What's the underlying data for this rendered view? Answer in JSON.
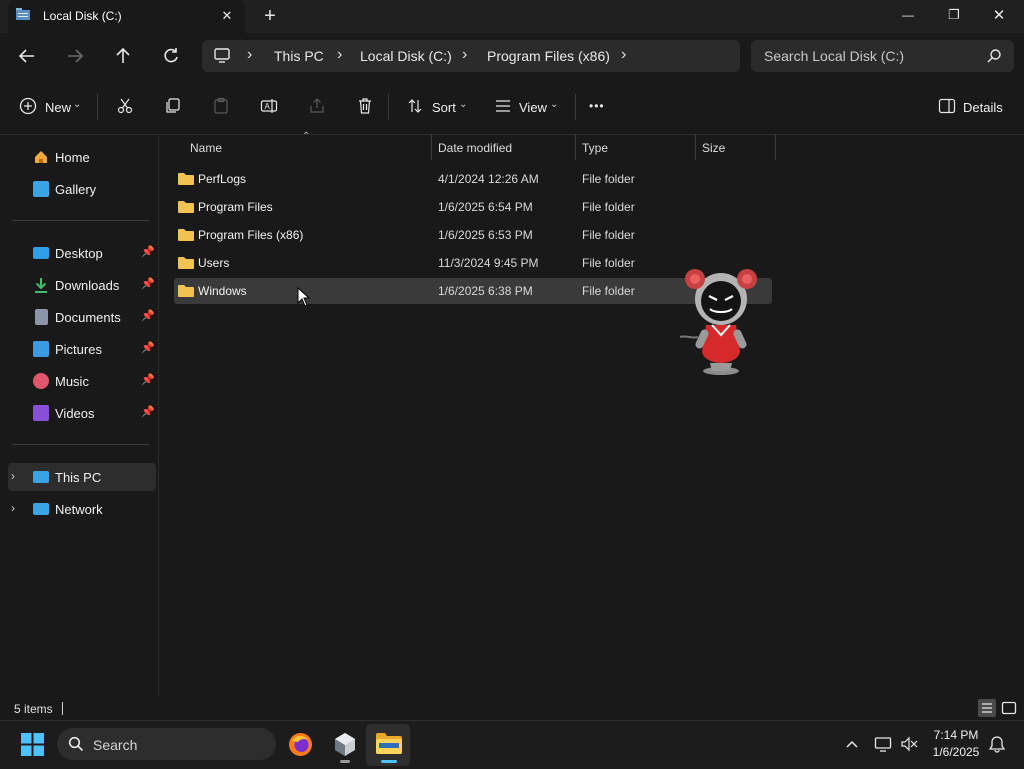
{
  "window": {
    "tab_title": "Local Disk (C:)",
    "new_tab": "+",
    "min": "—",
    "max": "❐",
    "close": "✕",
    "tab_close": "✕"
  },
  "address": {
    "crumbs": [
      "This PC",
      "Local Disk (C:)",
      "Program Files (x86)"
    ],
    "search_placeholder": "Search Local Disk (C:)"
  },
  "commands": {
    "new": "New",
    "sort": "Sort",
    "view": "View",
    "details": "Details",
    "more": "•••"
  },
  "nav": {
    "top": [
      {
        "label": "Home",
        "icon": "home-icon",
        "color": "#f4a93b"
      },
      {
        "label": "Gallery",
        "icon": "gallery-icon",
        "color": "#3aa3e6"
      }
    ],
    "pinned": [
      {
        "label": "Desktop",
        "icon": "desktop-icon",
        "color": "#2f9ee8"
      },
      {
        "label": "Downloads",
        "icon": "downloads-icon",
        "color": "#3fbf6a"
      },
      {
        "label": "Documents",
        "icon": "documents-icon",
        "color": "#8c96a6"
      },
      {
        "label": "Pictures",
        "icon": "pictures-icon",
        "color": "#3a9be3"
      },
      {
        "label": "Music",
        "icon": "music-icon",
        "color": "#e0566a"
      },
      {
        "label": "Videos",
        "icon": "videos-icon",
        "color": "#8a4fd8"
      }
    ],
    "roots": [
      {
        "label": "This PC",
        "icon": "this-pc-icon",
        "color": "#3aa3e6"
      },
      {
        "label": "Network",
        "icon": "network-icon",
        "color": "#3aa3e6"
      }
    ]
  },
  "columns": {
    "name": "Name",
    "date": "Date modified",
    "type": "Type",
    "size": "Size"
  },
  "files": [
    {
      "name": "PerfLogs",
      "date": "4/1/2024 12:26 AM",
      "type": "File folder"
    },
    {
      "name": "Program Files",
      "date": "1/6/2025 6:54 PM",
      "type": "File folder"
    },
    {
      "name": "Program Files (x86)",
      "date": "1/6/2025 6:53 PM",
      "type": "File folder"
    },
    {
      "name": "Users",
      "date": "11/3/2024 9:45 PM",
      "type": "File folder"
    },
    {
      "name": "Windows",
      "date": "1/6/2025 6:38 PM",
      "type": "File folder"
    }
  ],
  "status": {
    "count": "5 items"
  },
  "taskbar": {
    "search": "Search",
    "time": "7:14 PM",
    "date": "1/6/2025"
  },
  "colors": {
    "folder": "#f2c44f",
    "accent": "#4cc2ff"
  }
}
